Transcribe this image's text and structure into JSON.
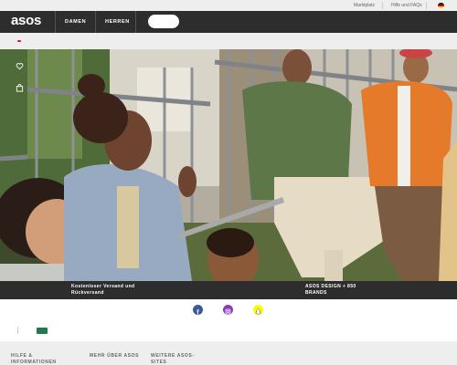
{
  "utility_bar": {
    "marketplace_label": "Marktplatz",
    "help_label": "Hilfe und FAQs",
    "country_flag_icon": "flag-germany-icon"
  },
  "header": {
    "logo_text": "asos",
    "tabs": [
      {
        "label": "DAMEN"
      },
      {
        "label": "HERREN"
      }
    ],
    "search_placeholder": ""
  },
  "hero": {
    "side_icons": [
      "heart-icon",
      "shopping-bag-icon"
    ],
    "caption_left": "Kostenloser Versand und Rückversand",
    "caption_right": "ASOS DESIGN + 850 BRANDS"
  },
  "social": [
    {
      "name": "facebook-icon",
      "color": "#3b5998"
    },
    {
      "name": "instagram-icon",
      "color": "#8a3ab9"
    },
    {
      "name": "snapchat-icon",
      "color": "#fffc00"
    }
  ],
  "footer": {
    "headings": [
      "HILFE & INFORMATIONEN",
      "MEHR ÜBER ASOS",
      "WEITERE ASOS-SITES"
    ]
  },
  "colors": {
    "header_bg": "#2d2d2d",
    "band_bg": "#eeeeee",
    "accent": "#d01345"
  }
}
